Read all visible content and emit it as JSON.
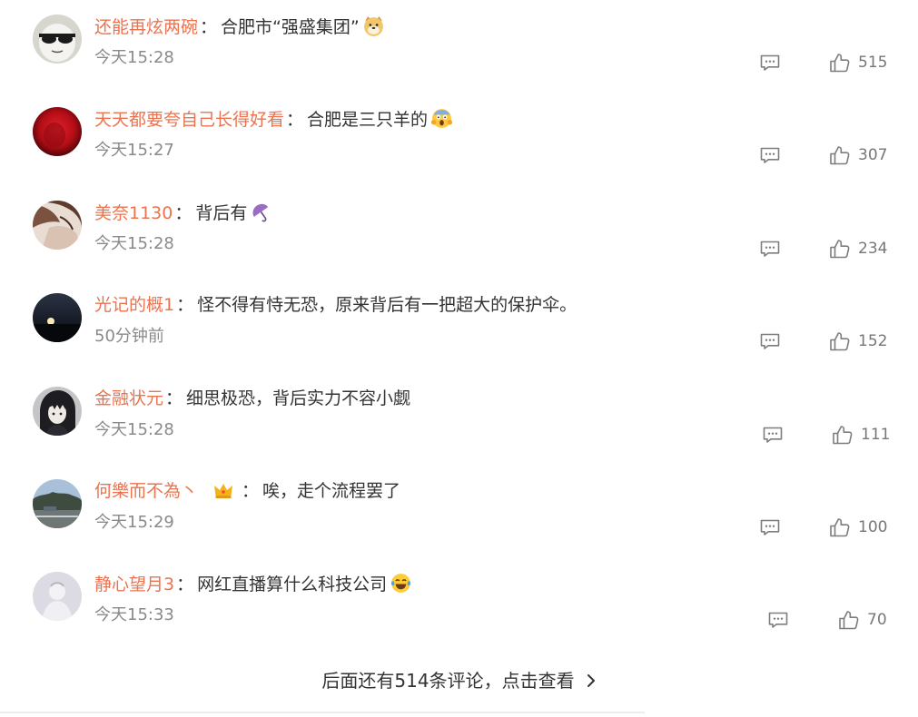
{
  "theme": {
    "username_color": "#eb7350",
    "text_color": "#333333",
    "meta_color": "#8a8a8a"
  },
  "comments": [
    {
      "username": "还能再炫两碗",
      "sep": "：",
      "text": "合肥市“强盛集团”",
      "emoji_icon": "doge-emoji-icon",
      "time": "今天15:28",
      "likes": "515"
    },
    {
      "username": "天天都要夸自己长得好看",
      "sep": "：",
      "text": "合肥是三只羊的",
      "emoji_icon": "screaming-face-emoji-icon",
      "time": "今天15:27",
      "likes": "307"
    },
    {
      "username": "美奈1130",
      "sep": "：",
      "text": "背后有",
      "emoji_icon": "umbrella-emoji-icon",
      "time": "今天15:28",
      "likes": "234"
    },
    {
      "username": "光记的概1",
      "sep": "：",
      "text": "怪不得有恃无恐，原来背后有一把超大的保护伞。",
      "time": "50分钟前",
      "likes": "152"
    },
    {
      "username": "金融状元",
      "sep": "：",
      "text": "细思极恐，背后实力不容小觑",
      "time": "今天15:28",
      "likes": "111"
    },
    {
      "username": "何樂而不為丶",
      "badge_icon": "crown-badge-icon",
      "sep": "：",
      "text": "唉，走个流程罢了",
      "time": "今天15:29",
      "likes": "100"
    },
    {
      "username": "静心望月3",
      "sep": "：",
      "text": "网红直播算什么科技公司",
      "emoji_icon": "laughing-crying-emoji-icon",
      "time": "今天15:33",
      "likes": "70"
    }
  ],
  "footer": {
    "more_label": "后面还有514条评论，点击查看"
  }
}
